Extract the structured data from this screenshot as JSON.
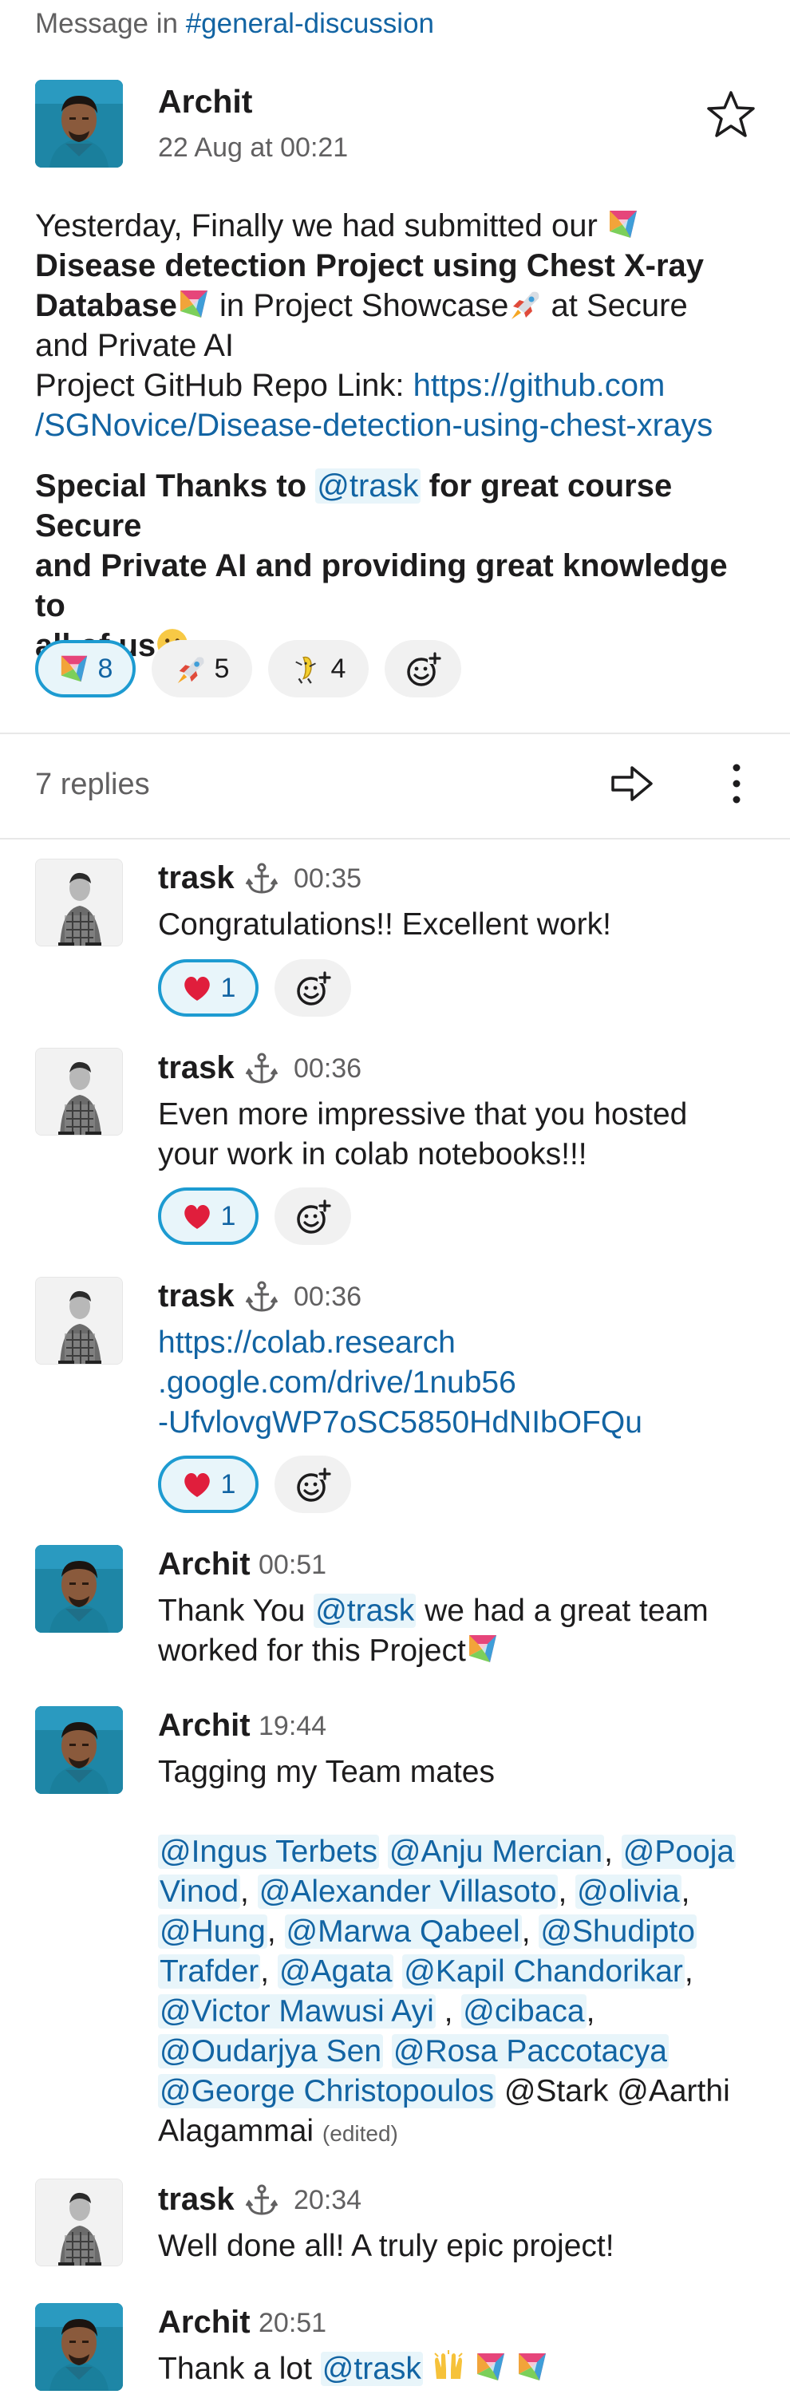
{
  "context": {
    "prefix": "Message in",
    "channel": "#general-discussion"
  },
  "main": {
    "author": "Archit",
    "date": "22 Aug at 00:21",
    "text": {
      "p1": "Yesterday, Finally we had submitted our",
      "bold1": "Disease detection Project using Chest X-ray",
      "bold2": "Database",
      "p2": "in Project Showcase",
      "p3": "at Secure",
      "p4": "and Private AI",
      "repo_label": "Project GitHub Repo Link:",
      "repo_link1": "https://github.com",
      "repo_link2": "/SGNovice/Disease-detection-using-chest-xrays",
      "thanks1": "Special Thanks to",
      "thanks_mention": "@trask",
      "thanks2": "for great course Secure",
      "thanks3": "and Private AI and providing great knowledge to",
      "thanks4": "all of us"
    },
    "reactions": [
      {
        "icon": "pyramid-emoji-icon",
        "count": "8"
      },
      {
        "icon": "rocket-emoji-icon",
        "count": "5"
      },
      {
        "icon": "dancing-banana-emoji-icon",
        "count": "4"
      }
    ]
  },
  "thread": {
    "replies_label": "7 replies"
  },
  "replies": [
    {
      "author": "trask",
      "time": "00:35",
      "text": "Congratulations!! Excellent work!",
      "reaction": "1"
    },
    {
      "author": "trask",
      "time": "00:36",
      "line1": "Even more impressive that you hosted",
      "line2": "your work in colab notebooks!!!",
      "reaction": "1"
    },
    {
      "author": "trask",
      "time": "00:36",
      "link1": "https://colab.research",
      "link2": ".google.com/drive/1nub56",
      "link3": "-UfvlovgWP7oSC5850HdNIbOFQu",
      "reaction": "1"
    },
    {
      "author": "Archit",
      "time": "00:51",
      "t1": "Thank You",
      "mention": "@trask",
      "t2": "we had a great team",
      "t3": "worked for this Project"
    },
    {
      "author": "Archit",
      "time": "19:44",
      "intro": "Tagging my Team mates",
      "mentions": {
        "m1": "@Ingus Terbets",
        "m2": "@Anju Mercian",
        "m3": "@Pooja",
        "m3b": "Vinod",
        "m4": "@Alexander Villasoto",
        "m5": "@olivia",
        "m6": "@Hung",
        "m7": "@Marwa Qabeel",
        "m8": "@Shudipto",
        "m8b": "Trafder",
        "m9": "@Agata",
        "m10": "@Kapil Chandorikar",
        "m11": "@Victor Mawusi Ayi",
        "m12": "@cibaca",
        "m13": "@Oudarjya Sen",
        "m14": "@Rosa Paccotacya",
        "m15": "@George Christopoulos",
        "plain1": "@Stark @Aarthi",
        "plain2": "Alagammai",
        "edited": "(edited)"
      }
    },
    {
      "author": "trask",
      "time": "20:34",
      "text": "Well done all! A truly epic project!"
    },
    {
      "author": "Archit",
      "time": "20:51",
      "t1": "Thank a lot",
      "mention": "@trask"
    }
  ],
  "colors": {
    "link": "#1264a3",
    "mention_bg": "#e8f5fa",
    "active_reaction_border": "#1d9bd1",
    "heart": "#e01e3c"
  }
}
